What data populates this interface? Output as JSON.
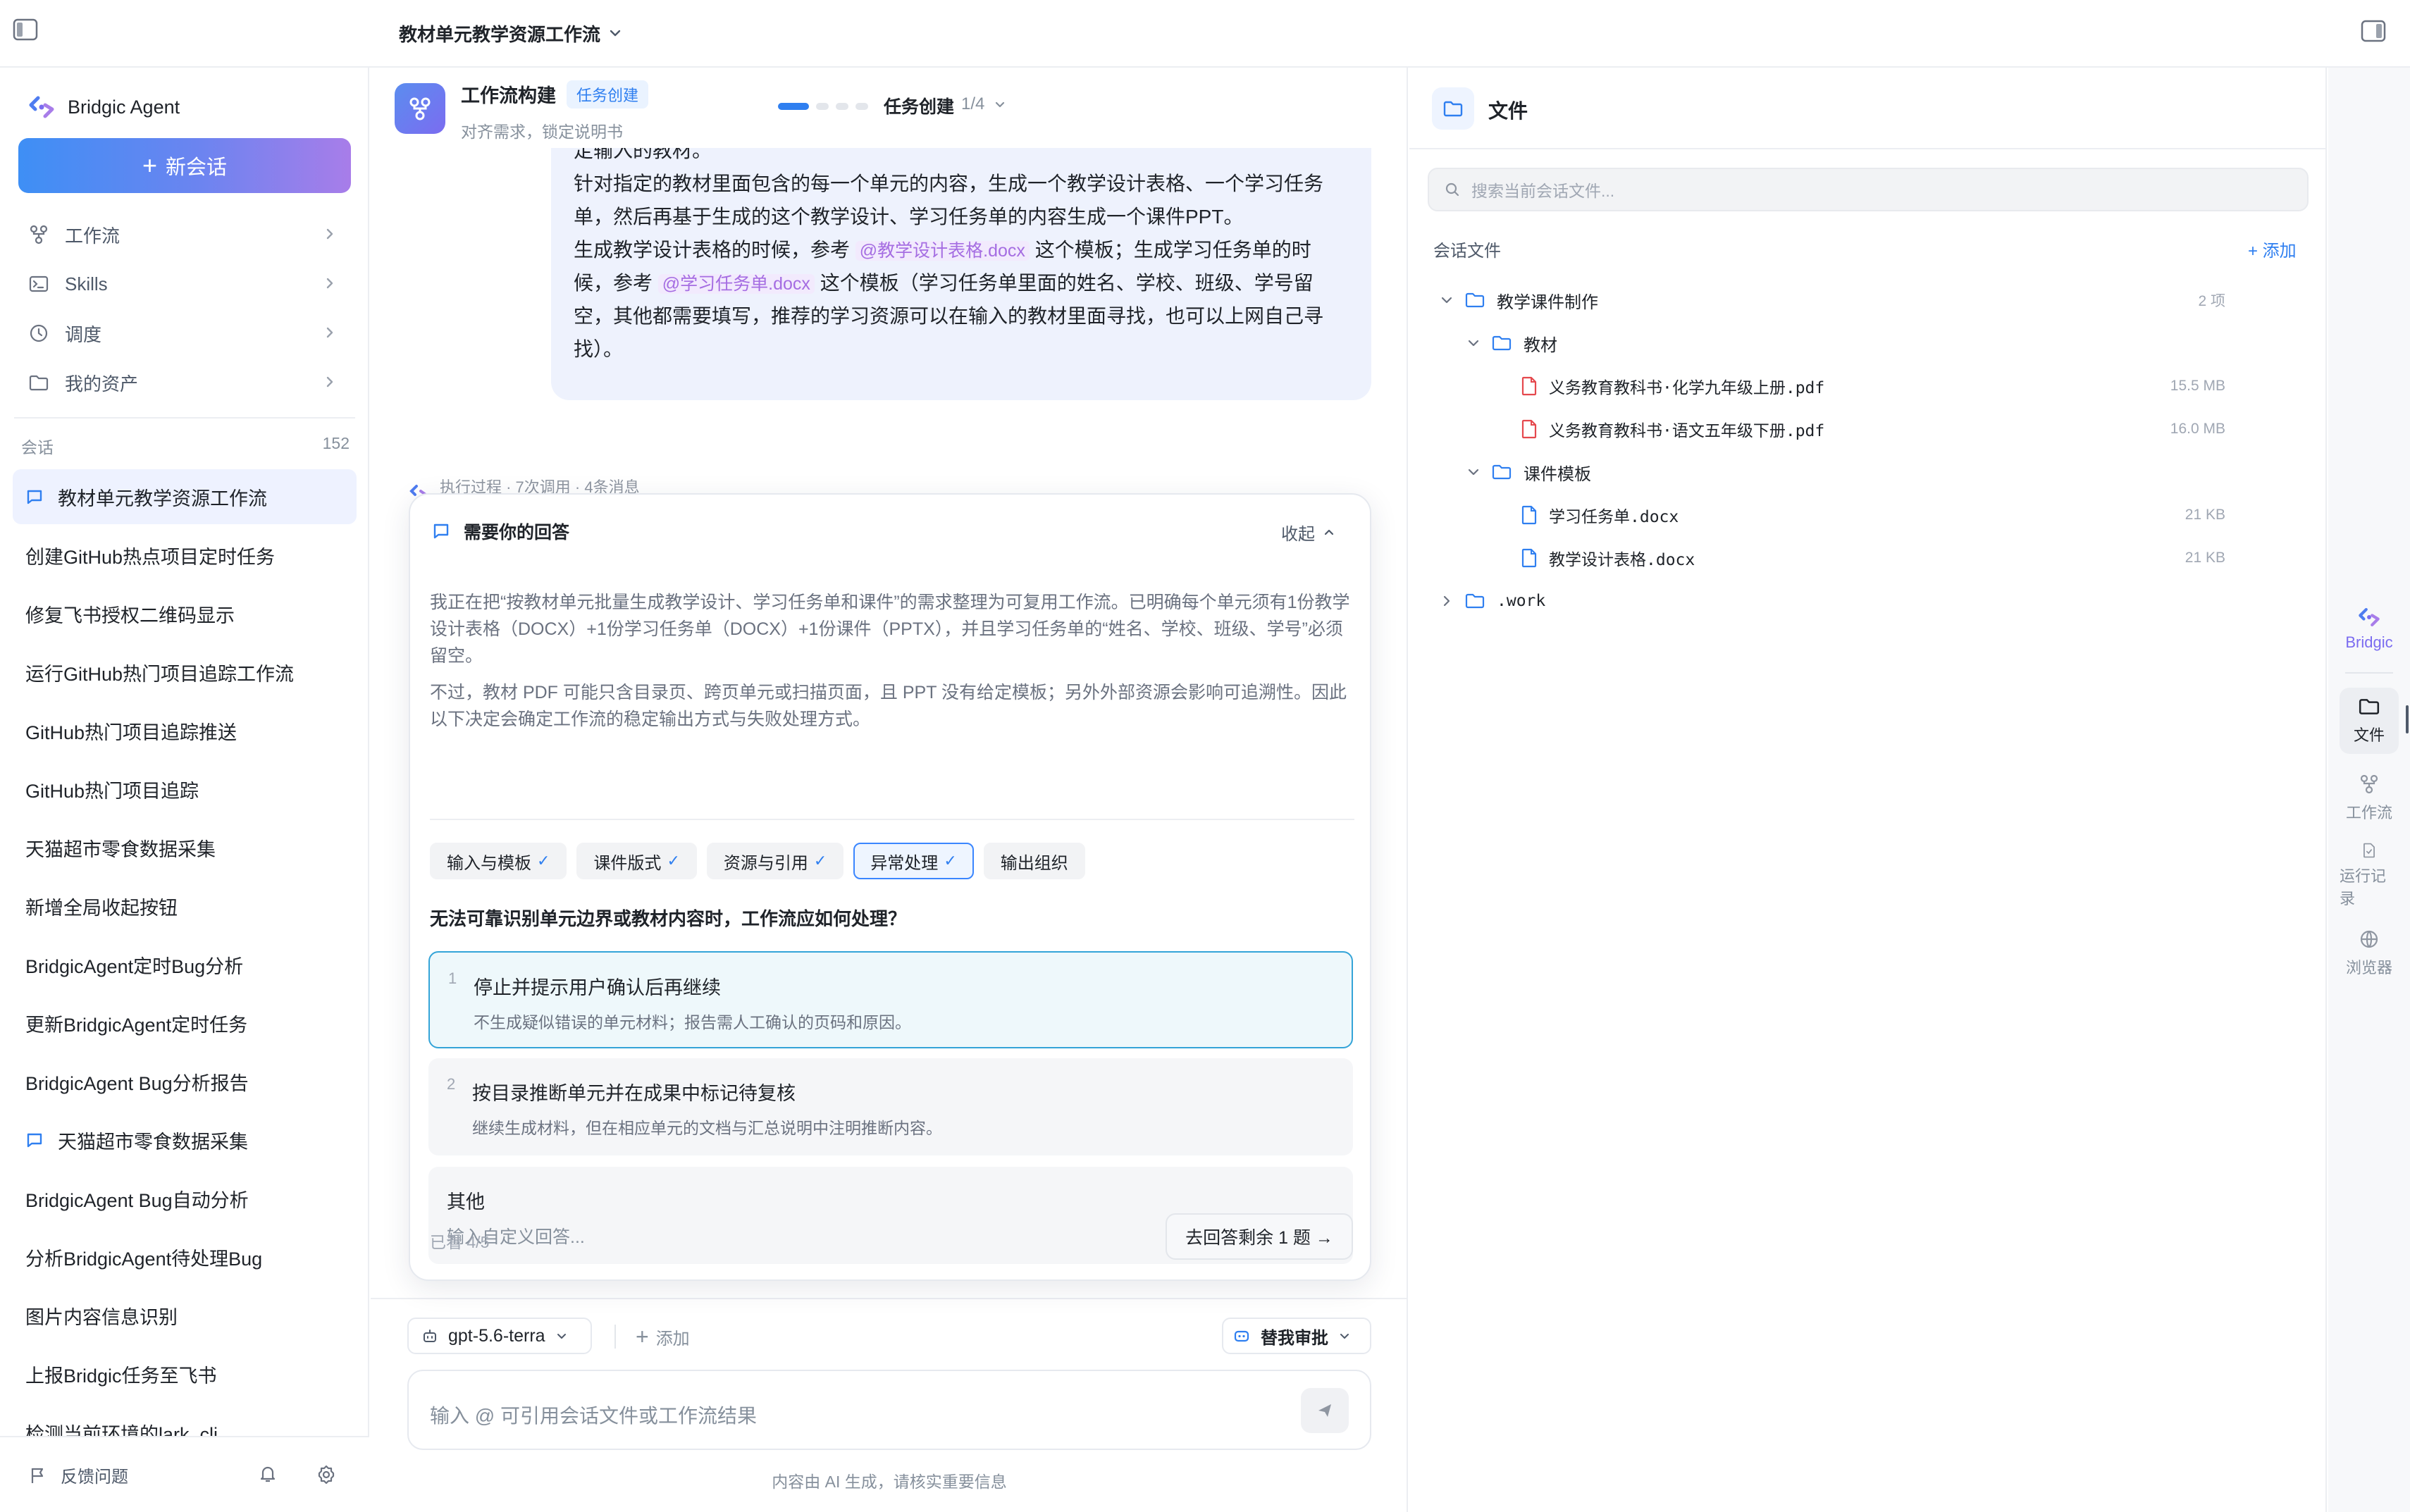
{
  "topbar": {
    "title": "教材单元教学资源工作流"
  },
  "sidebar": {
    "brand": "Bridgic Agent",
    "new_chat": "新会话",
    "nav": [
      {
        "label": "工作流",
        "icon": "workflow-icon"
      },
      {
        "label": "Skills",
        "icon": "terminal-icon"
      },
      {
        "label": "调度",
        "icon": "clock-icon"
      },
      {
        "label": "我的资产",
        "icon": "folder-icon"
      }
    ],
    "sessions_label": "会话",
    "sessions_count": "152",
    "sessions": [
      {
        "label": "教材单元教学资源工作流",
        "active": true,
        "icon": "chat-icon"
      },
      {
        "label": "创建GitHub热点项目定时任务"
      },
      {
        "label": "修复飞书授权二维码显示"
      },
      {
        "label": "运行GitHub热门项目追踪工作流"
      },
      {
        "label": "GitHub热门项目追踪推送"
      },
      {
        "label": "GitHub热门项目追踪"
      },
      {
        "label": "天猫超市零食数据采集"
      },
      {
        "label": "新增全局收起按钮"
      },
      {
        "label": "BridgicAgent定时Bug分析"
      },
      {
        "label": "更新BridgicAgent定时任务"
      },
      {
        "label": "BridgicAgent Bug分析报告"
      },
      {
        "label": "天猫超市零食数据采集",
        "icon": "chat-icon"
      },
      {
        "label": "BridgicAgent Bug自动分析"
      },
      {
        "label": "分析BridgicAgent待处理Bug"
      },
      {
        "label": "图片内容信息识别"
      },
      {
        "label": "上报Bridgic任务至飞书"
      },
      {
        "label": "检测当前环境的lark_cli"
      }
    ],
    "feedback": "反馈问题"
  },
  "workflow": {
    "title": "工作流构建",
    "badge": "任务创建",
    "subtitle": "对齐需求，锁定说明书",
    "step_name": "任务创建",
    "step_count": "1/4",
    "progress": {
      "current": 1,
      "total": 4
    }
  },
  "message": {
    "line1": "定输入的教材。",
    "line2": "针对指定的教材里面包含的每一个单元的内容，生成一个教学设计表格、一个学习任务",
    "line3": "单，然后再基于生成的这个教学设计、学习任务单的内容生成一个课件PPT。",
    "line4_a": "生成教学设计表格的时候，参考",
    "line4_mention": "@教学设计表格.docx",
    "line4_b": "这个模板；生成学习任务单的时",
    "line5_a": "候，参考",
    "line5_mention": "@学习任务单.docx",
    "line5_b": "这个模板（学习任务单里面的姓名、学校、班级、学号留",
    "line6": "空，其他都需要填写，推荐的学习资源可以在输入的教材里面寻找，也可以上网自己寻",
    "line7": "找）。"
  },
  "behind_text": "执行过程 · 7次调用 · 4条消息",
  "question_card": {
    "header": "需要你的回答",
    "collapse": "收起",
    "intro": "我正在把“按教材单元批量生成教学设计、学习任务单和课件”的需求整理为可复用工作流。已明确每个单元须有1份教学设计表格（DOCX）+1份学习任务单（DOCX）+1份课件（PPTX），并且学习任务单的“姓名、学校、班级、学号”必须留空。",
    "intro2": "不过，教材 PDF 可能只含目录页、跨页单元或扫描页面，且 PPT 没有给定模板；另外外部资源会影响可追溯性。因此以下决定会确定工作流的稳定输出方式与失败处理方式。",
    "tabs": [
      {
        "label": "输入与模板",
        "done": true
      },
      {
        "label": "课件版式",
        "done": true
      },
      {
        "label": "资源与引用",
        "done": true
      },
      {
        "label": "异常处理",
        "done": true,
        "active": true
      },
      {
        "label": "输出组织",
        "done": false
      }
    ],
    "check_mark": "✓",
    "question": "无法可靠识别单元边界或教材内容时，工作流应如何处理？",
    "options": [
      {
        "num": "1",
        "title": "停止并提示用户确认后再继续",
        "desc": "不生成疑似错误的单元材料；报告需人工确认的页码和原因。",
        "selected": true
      },
      {
        "num": "2",
        "title": "按目录推断单元并在成果中标记待复核",
        "desc": "继续生成材料，但在相应单元的文档与汇总说明中注明推断内容。"
      }
    ],
    "other_label": "其他",
    "other_placeholder": "输入自定义回答...",
    "seen": "已看 4/5",
    "next_button": "去回答剩余 1 题 →"
  },
  "composer": {
    "model": "gpt-5.6-terra",
    "add": "添加",
    "approve": "替我审批",
    "placeholder": "输入 @ 可引用会话文件或工作流结果",
    "disclaimer": "内容由 AI 生成，请核实重要信息"
  },
  "files": {
    "title": "文件",
    "search_placeholder": "搜索当前会话文件...",
    "section": "会话文件",
    "add": "+ 添加",
    "tree": [
      {
        "name": "教学课件制作",
        "type": "folder",
        "level": 0,
        "open": true,
        "meta": "2 项"
      },
      {
        "name": "教材",
        "type": "folder",
        "level": 1,
        "open": true
      },
      {
        "name": "义务教育教科书·化学九年级上册.pdf",
        "type": "pdf",
        "level": 2,
        "meta": "15.5 MB"
      },
      {
        "name": "义务教育教科书·语文五年级下册.pdf",
        "type": "pdf",
        "level": 2,
        "meta": "16.0 MB"
      },
      {
        "name": "课件模板",
        "type": "folder",
        "level": 1,
        "open": true
      },
      {
        "name": "学习任务单.docx",
        "type": "doc",
        "level": 2,
        "meta": "21 KB"
      },
      {
        "name": "教学设计表格.docx",
        "type": "doc",
        "level": 2,
        "meta": "21 KB"
      },
      {
        "name": ".work",
        "type": "folder",
        "level": 0,
        "open": false
      }
    ]
  },
  "rail": {
    "items": [
      {
        "label": "Bridgic"
      },
      {
        "label": "文件",
        "active": true
      },
      {
        "label": "工作流"
      },
      {
        "label": "运行记录"
      },
      {
        "label": "浏览器"
      }
    ]
  },
  "colors": {
    "accent": "#2f7ff0",
    "selected_option": "#34a4d8",
    "brand_purple": "#a87de9",
    "pdf_red": "#e5484d"
  }
}
